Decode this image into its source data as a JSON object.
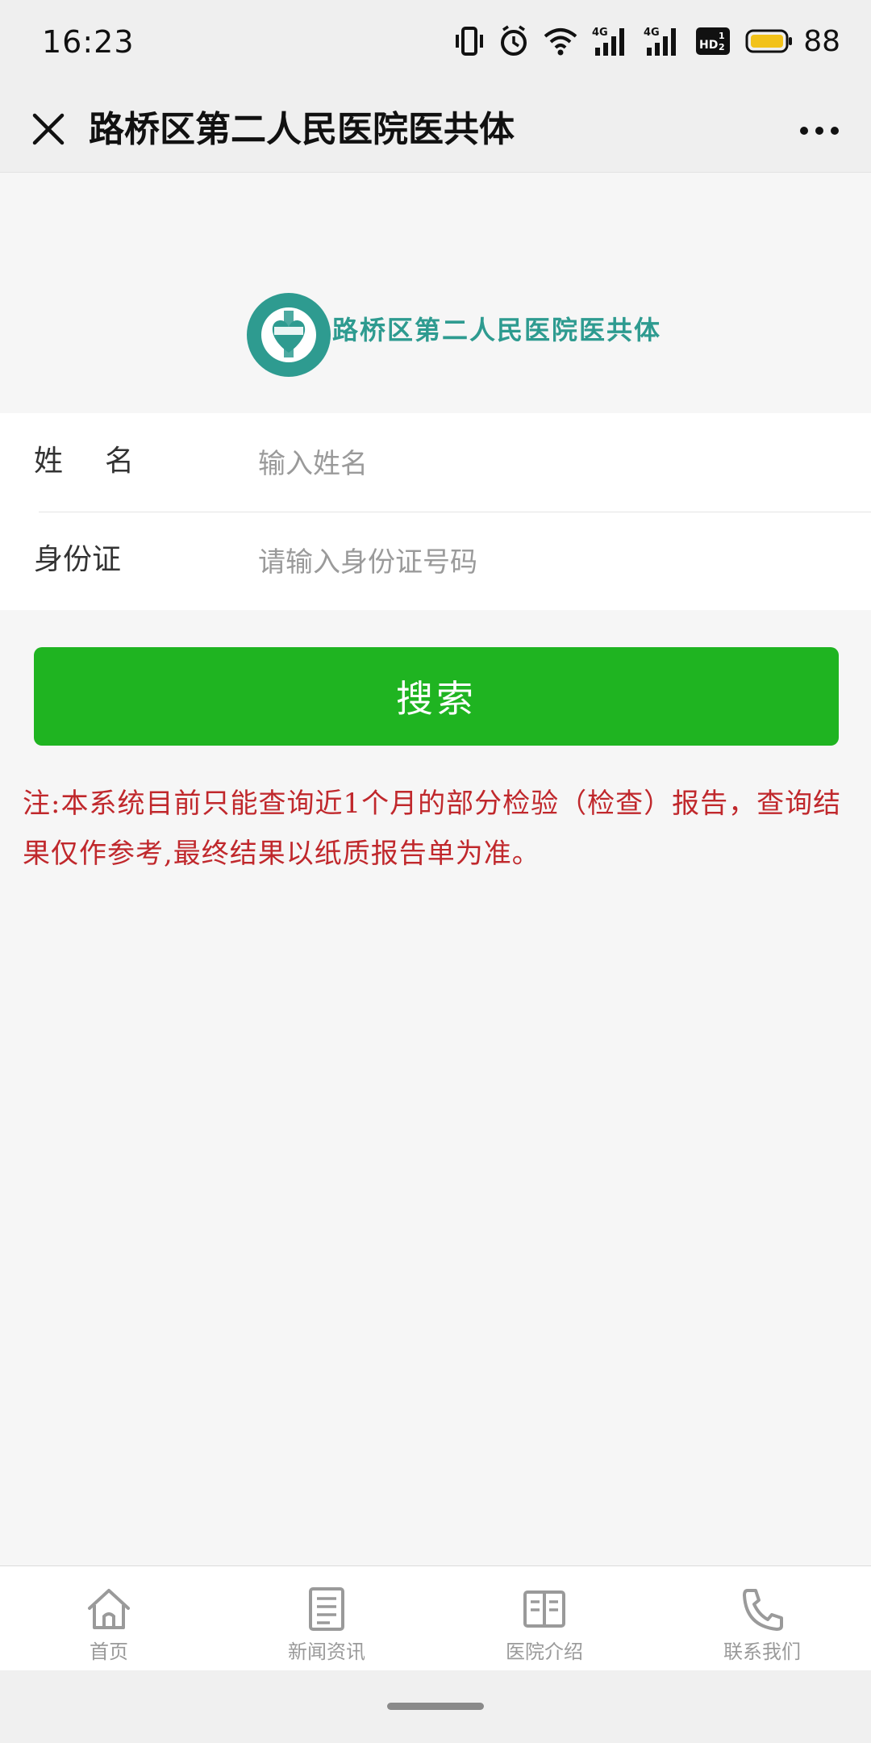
{
  "status_bar": {
    "time": "16:23",
    "battery": "88",
    "icons": [
      "vibrate-icon",
      "alarm-icon",
      "wifi-icon",
      "signal-4g-icon",
      "signal-4g-icon",
      "hd-icon",
      "battery-icon"
    ]
  },
  "nav": {
    "title": "路桥区第二人民医院医共体",
    "close_icon": "close-icon",
    "more_icon": "more-icon"
  },
  "logo": {
    "text": "路桥区第二人民医院医共体",
    "emblem_ring_text": "路桥区第二人民医院医共体",
    "color": "#2e9b90"
  },
  "form": {
    "name_label": "姓名",
    "name_placeholder": "输入姓名",
    "id_label": "身份证",
    "id_placeholder": "请输入身份证号码"
  },
  "search_button": {
    "label": "搜索",
    "color": "#1fb421"
  },
  "notice": {
    "text": "注:本系统目前只能查询近1个月的部分检验（检查）报告，查询结果仅作参考,最终结果以纸质报告单为准。",
    "color": "#c0282c"
  },
  "tabs": [
    {
      "label": "首页",
      "icon": "home-icon"
    },
    {
      "label": "新闻资讯",
      "icon": "news-icon"
    },
    {
      "label": "医院介绍",
      "icon": "book-icon"
    },
    {
      "label": "联系我们",
      "icon": "phone-icon"
    }
  ]
}
